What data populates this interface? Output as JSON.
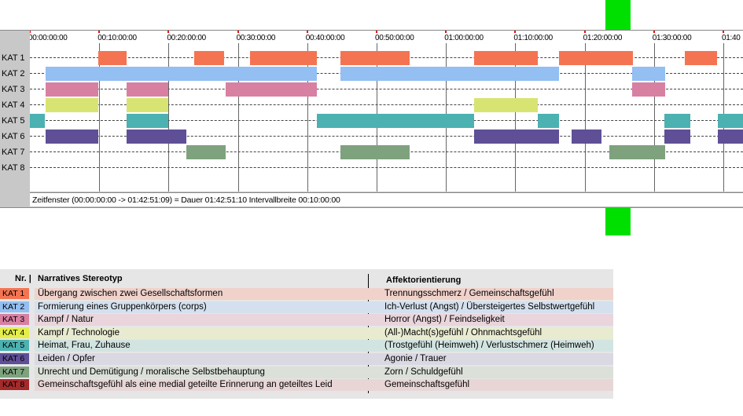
{
  "timeline": {
    "ticks": [
      "00:00:00:00",
      "00:10:00:00",
      "00:20:00:00",
      "00:30:00:00",
      "00:40:00:00",
      "00:50:00:00",
      "01:00:00:00",
      "01:10:00:00",
      "01:20:00:00",
      "01:30:00:00",
      "01:40"
    ],
    "rows": [
      "KAT 1",
      "KAT 2",
      "KAT 3",
      "KAT 4",
      "KAT 5",
      "KAT 6",
      "KAT 7",
      "KAT 8"
    ],
    "colors": [
      "#f47452",
      "#93bff2",
      "#d880a2",
      "#d8e472",
      "#4cb1b1",
      "#5f4f96",
      "#7ea27e",
      "#a52a2a"
    ],
    "status": "Zeitfenster (00:00:00:00 -> 01:42:51:09) = Dauer 01:42:51:10     Intervallbreite 00:10:00:00",
    "segments": [
      [
        [
          9.9,
          14.0
        ],
        [
          23.7,
          28.0
        ],
        [
          31.7,
          41.4
        ],
        [
          44.8,
          54.8
        ],
        [
          64.1,
          73.2
        ],
        [
          76.3,
          87.0
        ],
        [
          94.4,
          99.1
        ]
      ],
      [
        [
          2.3,
          41.4
        ],
        [
          44.8,
          76.3
        ],
        [
          86.9,
          91.6
        ]
      ],
      [
        [
          2.3,
          9.9
        ],
        [
          13.9,
          19.9
        ],
        [
          28.2,
          41.4
        ],
        [
          86.9,
          91.6
        ]
      ],
      [
        [
          2.3,
          9.9
        ],
        [
          13.9,
          19.9
        ],
        [
          64.1,
          73.2
        ]
      ],
      [
        [
          0.0,
          2.2
        ],
        [
          13.9,
          19.9
        ],
        [
          41.4,
          64.1
        ],
        [
          73.2,
          76.3
        ],
        [
          91.5,
          95.2
        ],
        [
          99.2,
          103.0
        ]
      ],
      [
        [
          2.3,
          9.9
        ],
        [
          13.9,
          22.6
        ],
        [
          64.1,
          76.3
        ],
        [
          78.1,
          82.4
        ],
        [
          91.5,
          95.2
        ],
        [
          99.2,
          103.0
        ]
      ],
      [
        [
          22.6,
          28.2
        ],
        [
          44.8,
          54.8
        ],
        [
          83.6,
          91.6
        ]
      ],
      []
    ]
  },
  "legend": {
    "header_nr": "Nr. |",
    "header_stereotype": "Narratives Stereotyp",
    "header_affekt": "Affektorientierung",
    "rows": [
      {
        "code": "KAT 1",
        "name": "Übergang zwischen zwei Gesellschaftsformen",
        "aff": "Trennungsschmerz / Gemeinschaftsgefühl",
        "color": "#f47452",
        "bg": "#f0d2cb"
      },
      {
        "code": "KAT 2",
        "name": "Formierung eines Gruppenkörpers (corps)",
        "aff": "Ich-Verlust (Angst) / Übersteigertes Selbstwertgefühl",
        "color": "#93bff2",
        "bg": "#d5e0ee"
      },
      {
        "code": "KAT 3",
        "name": "Kampf / Natur",
        "aff": "Horror (Angst) / Feindseligkeit",
        "color": "#d880a2",
        "bg": "#ead5dc"
      },
      {
        "code": "KAT 4",
        "name": "Kampf / Technologie",
        "aff": "(All-)Macht(s)gefühl / Ohnmachtsgefühl",
        "color": "#e4ee4a",
        "bg": "#e9ebd1"
      },
      {
        "code": "KAT 5",
        "name": "Heimat, Frau, Zuhause",
        "aff": "(Trostgefühl (Heimweh) / Verlustschmerz (Heimweh)",
        "color": "#4cb1b1",
        "bg": "#d2e4e2"
      },
      {
        "code": "KAT 6",
        "name": "Leiden / Opfer",
        "aff": "Agonie / Trauer",
        "color": "#5f4f96",
        "bg": "#dad8e3"
      },
      {
        "code": "KAT 7",
        "name": "Unrecht und Demütigung / moralische Selbstbehauptung",
        "aff": "Zorn / Schuldgefühl",
        "color": "#7ea27e",
        "bg": "#dbe0d9"
      },
      {
        "code": "KAT 8",
        "name": "Gemeinschaftsgefühl als eine medial geteilte Erinnerung an geteiltes Leid",
        "aff": "Gemeinschaftsgefühl",
        "color": "#a52a2a",
        "bg": "#e8d6d6"
      }
    ]
  }
}
